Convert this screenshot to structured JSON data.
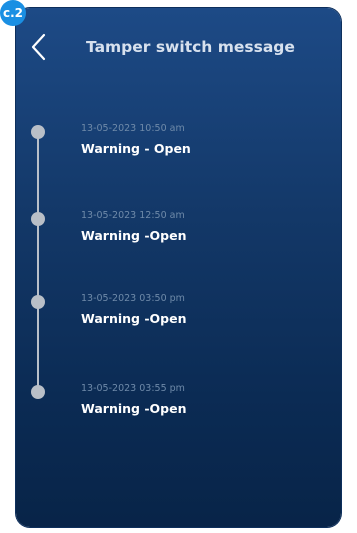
{
  "badge": {
    "label": "c.2"
  },
  "header": {
    "back_icon": "chevron-left-icon",
    "title": "Tamper switch message"
  },
  "timeline": {
    "entries": [
      {
        "time": "13-05-2023  10:50 am",
        "status": "Warning - Open"
      },
      {
        "time": "13-05-2023  12:50 am",
        "status": "Warning -Open"
      },
      {
        "time": "13-05-2023  03:50 pm",
        "status": "Warning -Open"
      },
      {
        "time": "13-05-2023  03:55 pm",
        "status": "Warning -Open"
      }
    ]
  },
  "colors": {
    "background_top": "#1d4a86",
    "background_bottom": "#082448",
    "badge": "#1a8fe3",
    "timeline": "#b9c0c9",
    "time_text": "#6f8aa9",
    "status_text": "#ffffff"
  }
}
